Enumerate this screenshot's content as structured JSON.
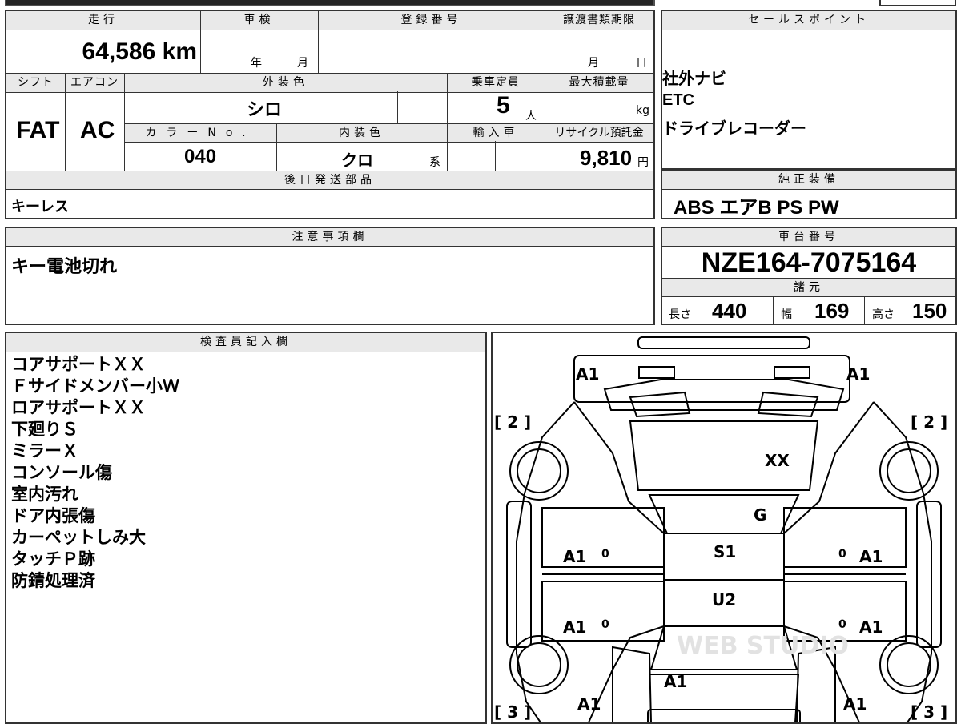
{
  "top": {
    "mileage_label": "走行",
    "mileage_value": "64,586 km",
    "inspection_label": "車検",
    "inspection_year": "年",
    "inspection_month": "月",
    "registration_label": "登録番号",
    "transfer_label": "譲渡書類期限",
    "transfer_month": "月",
    "transfer_day": "日",
    "shift_label": "シフト",
    "shift_value": "FAT",
    "ac_label": "エアコン",
    "ac_value": "AC",
    "exterior_label": "外装色",
    "exterior_value": "シロ",
    "capacity_label": "乗車定員",
    "capacity_value": "5",
    "capacity_unit": "人",
    "maxload_label": "最大積載量",
    "maxload_unit": "kg",
    "color_no_label": "カラーNo.",
    "color_no_value": "040",
    "interior_label": "内装色",
    "interior_value": "クロ",
    "interior_unit": "系",
    "import_label": "輸入車",
    "recycle_label": "リサイクル預託金",
    "recycle_value": "9,810",
    "recycle_unit": "円",
    "later_parts_label": "後日発送部品",
    "later_parts_value": "キーレス"
  },
  "sales": {
    "label": "セールスポイント",
    "items": [
      "社外ナビ",
      "ETC",
      "ドライブレコーダー"
    ]
  },
  "equipment": {
    "label": "純正装備",
    "value": "ABS エアB PS PW"
  },
  "notes": {
    "label": "注意事項欄",
    "value": "キー電池切れ"
  },
  "chassis": {
    "label": "車台番号",
    "value": "NZE164-7075164",
    "spec_label": "諸元",
    "length_label": "長さ",
    "length_value": "440",
    "width_label": "幅",
    "width_value": "169",
    "height_label": "高さ",
    "height_value": "150"
  },
  "inspector": {
    "label": "検査員記入欄",
    "items": [
      "コアサポートＸＸ",
      "Ｆサイドメンバー小Ｗ",
      "ロアサポートＸＸ",
      "下廻りＳ",
      "ミラーＸ",
      "コンソール傷",
      "室内汚れ",
      "ドア内張傷",
      "カーペットしみ大",
      "タッチＰ跡",
      "防錆処理済"
    ]
  },
  "diagram": {
    "front_left": "A1",
    "front_right": "A1",
    "bracket_front_left": "[ 2 ]",
    "bracket_front_right": "[ 2 ]",
    "bracket_rear_left": "[ 3 ]",
    "bracket_rear_right": "[ 3 ]",
    "hood": "XX",
    "windshield": "G",
    "roof": "S1",
    "roof_rear": "U2",
    "left_front_door": "A1",
    "left_rear_door": "A1",
    "right_front_door": "A1",
    "right_rear_door": "A1",
    "left_front_door_mark": "0",
    "left_rear_door_mark": "0",
    "right_front_door_mark": "0",
    "right_rear_door_mark": "0",
    "rear_glass": "A1",
    "rear_left": "A1",
    "rear_right": "A1",
    "watermark": "WEB STUDIO"
  }
}
